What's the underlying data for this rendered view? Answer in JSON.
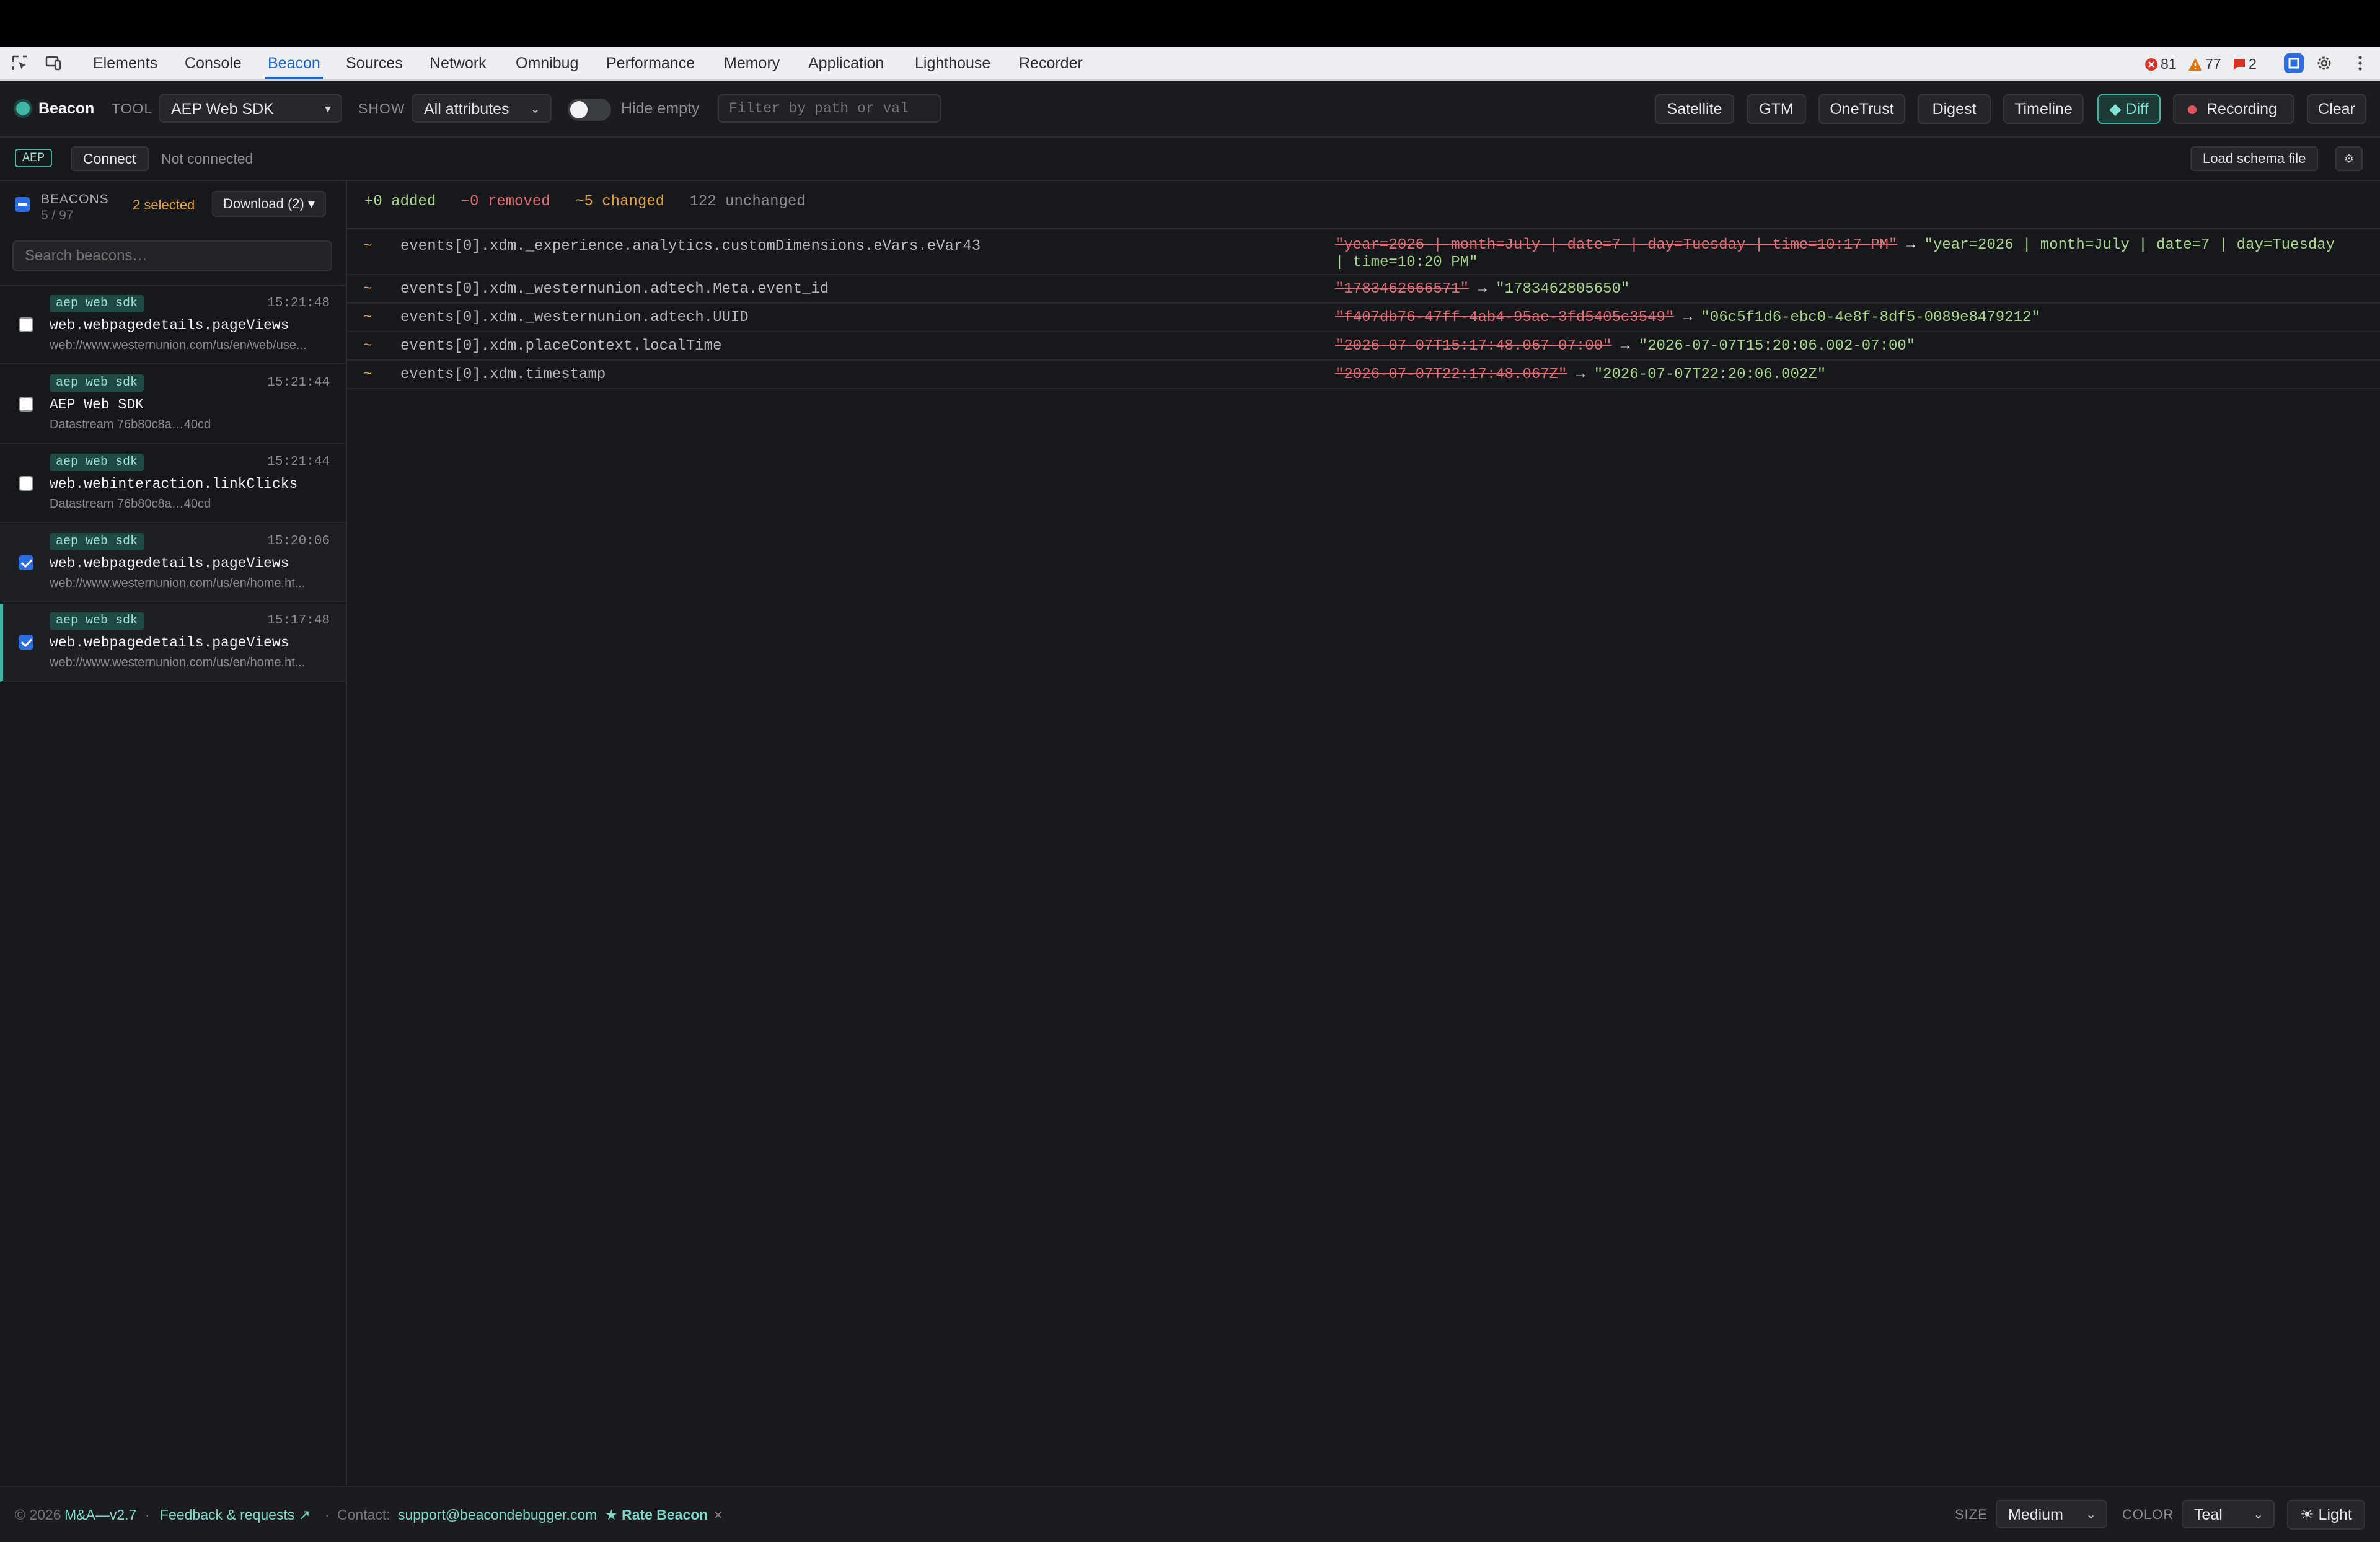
{
  "devtools": {
    "tabs": [
      "Elements",
      "Console",
      "Beacon",
      "Sources",
      "Network",
      "Omnibug",
      "Performance",
      "Memory",
      "Application",
      "Lighthouse",
      "Recorder"
    ],
    "active_tab": "Beacon",
    "errors": "81",
    "warnings": "77",
    "issues": "2"
  },
  "toolbar": {
    "brand": "Beacon",
    "tool_label": "TOOL",
    "tool_value": "AEP Web SDK",
    "show_label": "SHOW",
    "show_value": "All attributes",
    "hide_empty_label": "Hide empty",
    "filter_placeholder": "Filter by path or val",
    "buttons": {
      "satellite": "Satellite",
      "gtm": "GTM",
      "onetrust": "OneTrust",
      "digest": "Digest",
      "timeline": "Timeline",
      "diff": "◆ Diff",
      "recording": "Recording",
      "clear": "Clear"
    }
  },
  "connect_bar": {
    "badge": "AEP",
    "connect": "Connect",
    "status": "Not connected",
    "load_schema": "Load schema file",
    "settings_glyph": "⚙"
  },
  "sidebar": {
    "title": "BEACONS",
    "count": "5 / 97",
    "selected": "2 selected",
    "download": "Download (2) ▾",
    "search_placeholder": "Search beacons…",
    "items": [
      {
        "tag": "aep web sdk",
        "time": "15:21:48",
        "name": "web.webpagedetails.pageViews",
        "sub": "web://www.westernunion.com/us/en/web/use...",
        "checked": false
      },
      {
        "tag": "aep web sdk",
        "time": "15:21:44",
        "name": "AEP Web SDK",
        "sub": "Datastream 76b80c8a…40cd",
        "checked": false
      },
      {
        "tag": "aep web sdk",
        "time": "15:21:44",
        "name": "web.webinteraction.linkClicks",
        "sub": "Datastream 76b80c8a…40cd",
        "checked": false
      },
      {
        "tag": "aep web sdk",
        "time": "15:20:06",
        "name": "web.webpagedetails.pageViews",
        "sub": "web://www.westernunion.com/us/en/home.ht...",
        "checked": true
      },
      {
        "tag": "aep web sdk",
        "time": "15:17:48",
        "name": "web.webpagedetails.pageViews",
        "sub": "web://www.westernunion.com/us/en/home.ht...",
        "checked": true
      }
    ]
  },
  "diff": {
    "summary": {
      "added": "+0 added",
      "removed": "−0 removed",
      "changed": "~5 changed",
      "unchanged": "122 unchanged"
    },
    "rows": [
      {
        "marker": "~",
        "path": "events[0].xdm._experience.analytics.customDimensions.eVars.eVar43",
        "old": "\"year=2026 | month=July | date=7 | day=Tuesday | time=10:17 PM\"",
        "arrow": "→",
        "new": "\"year=2026 | month=July | date=7 | day=Tuesday | time=10:20 PM\""
      },
      {
        "marker": "~",
        "path": "events[0].xdm._westernunion.adtech.Meta.event_id",
        "old": "\"1783462666571\"",
        "arrow": "→",
        "new": "\"1783462805650\""
      },
      {
        "marker": "~",
        "path": "events[0].xdm._westernunion.adtech.UUID",
        "old": "\"f407db76-47ff-4ab4-95ae-3fd5405c3549\"",
        "arrow": "→",
        "new": "\"06c5f1d6-ebc0-4e8f-8df5-0089e8479212\""
      },
      {
        "marker": "~",
        "path": "events[0].xdm.placeContext.localTime",
        "old": "\"2026-07-07T15:17:48.067-07:00\"",
        "arrow": "→",
        "new": "\"2026-07-07T15:20:06.002-07:00\""
      },
      {
        "marker": "~",
        "path": "events[0].xdm.timestamp",
        "old": "\"2026-07-07T22:17:48.067Z\"",
        "arrow": "→",
        "new": "\"2026-07-07T22:20:06.002Z\""
      }
    ]
  },
  "footer": {
    "copyright": "© 2026",
    "brand_version": "M&A—v2.7",
    "separator": "·",
    "feedback": "Feedback & requests ↗",
    "contact_label": "Contact:",
    "contact_email": "support@beacondebugger.com",
    "rate": "★ Rate Beacon",
    "close": "×",
    "size_label": "SIZE",
    "size_value": "Medium",
    "color_label": "COLOR",
    "color_value": "Teal",
    "theme": "☀ Light"
  },
  "colors": {
    "accent": "#3fb6a4",
    "removed": "#e06c75",
    "added": "#a8d68a",
    "changed": "#e6a23c"
  }
}
